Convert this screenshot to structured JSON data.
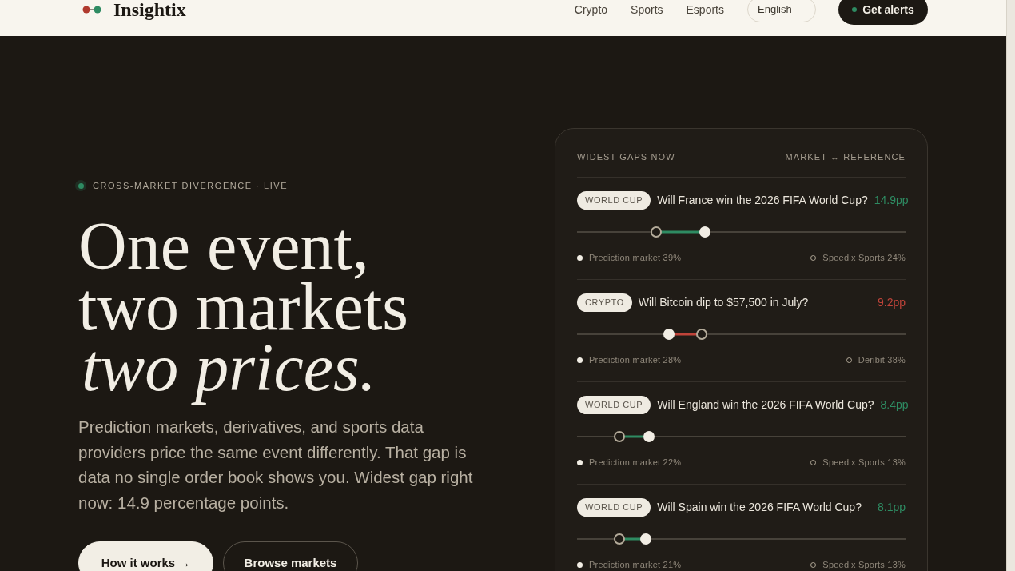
{
  "header": {
    "brand": "Insightix",
    "nav": [
      "Crypto",
      "Sports",
      "Esports"
    ],
    "language": {
      "value": "English"
    },
    "cta": "Get alerts"
  },
  "hero": {
    "eyebrow": "CROSS-MARKET DIVERGENCE · LIVE",
    "headline": [
      {
        "text": "One event,",
        "italic": false
      },
      {
        "text": "two markets",
        "italic": false
      },
      {
        "text": "two prices.",
        "italic": true
      }
    ],
    "intro": "Prediction markets, derivatives, and sports data providers price the same event differently. That gap is data no single order book shows you. Widest gap right now: 14.9 percentage points.",
    "buttons": [
      {
        "label": "How it works →",
        "kind": "primary"
      },
      {
        "label": "Browse markets",
        "kind": "secondary"
      }
    ]
  },
  "gaps": {
    "title": "WIDEST GAPS NOW",
    "legend": "MARKET ↔ REFERENCE",
    "items": [
      {
        "tag": "WORLD CUP",
        "question": "Will France win the 2026 FIFA World Cup?",
        "gap": "14.9pp",
        "color": "#2e8b62",
        "track": [
          {
            "kind": "reference",
            "level": 0.24
          },
          {
            "kind": "market",
            "level": 0.39
          }
        ],
        "sources": [
          {
            "kind": "market",
            "label": "Prediction market 39%"
          },
          {
            "kind": "reference",
            "label": "Speedix Sports 24%"
          }
        ]
      },
      {
        "tag": "CRYPTO",
        "question": "Will Bitcoin dip to $57,500 in July?",
        "gap": "9.2pp",
        "color": "#c0443a",
        "track": [
          {
            "kind": "market",
            "level": 0.28
          },
          {
            "kind": "reference",
            "level": 0.38
          }
        ],
        "sources": [
          {
            "kind": "market",
            "label": "Prediction market 28%"
          },
          {
            "kind": "reference",
            "label": "Deribit 38%"
          }
        ]
      },
      {
        "tag": "WORLD CUP",
        "question": "Will England win the 2026 FIFA World Cup?",
        "gap": "8.4pp",
        "color": "#2e8b62",
        "track": [
          {
            "kind": "reference",
            "level": 0.13
          },
          {
            "kind": "market",
            "level": 0.22
          }
        ],
        "sources": [
          {
            "kind": "market",
            "label": "Prediction market 22%"
          },
          {
            "kind": "reference",
            "label": "Speedix Sports 13%"
          }
        ]
      },
      {
        "tag": "WORLD CUP",
        "question": "Will Spain win the 2026 FIFA World Cup?",
        "gap": "8.1pp",
        "color": "#2e8b62",
        "track": [
          {
            "kind": "reference",
            "level": 0.13
          },
          {
            "kind": "market",
            "level": 0.21
          }
        ],
        "sources": [
          {
            "kind": "market",
            "label": "Prediction market 21%"
          },
          {
            "kind": "reference",
            "label": "Speedix Sports 13%"
          }
        ]
      }
    ]
  }
}
